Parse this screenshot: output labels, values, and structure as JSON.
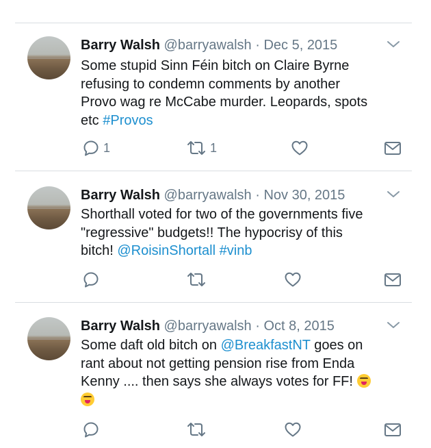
{
  "tweets": [
    {
      "author_name": "Barry Walsh",
      "handle": "@barryawalsh",
      "separator": "·",
      "date": "Dec 5, 2015",
      "text_lines": [
        [
          {
            "t": "Some stupid Sinn Féin bitch on Claire Byrne"
          }
        ],
        [
          {
            "t": "refusing to condemn comments by another"
          }
        ],
        [
          {
            "t": "Provo wag re McCabe murder. Leopards, spots"
          }
        ],
        [
          {
            "t": "etc "
          },
          {
            "t": "#Provos",
            "link": true
          }
        ]
      ],
      "reply_count": "1",
      "retweet_count": "1"
    },
    {
      "author_name": "Barry Walsh",
      "handle": "@barryawalsh",
      "separator": "·",
      "date": "Nov 30, 2015",
      "text_lines": [
        [
          {
            "t": "Shorthall voted for two of the governments five"
          }
        ],
        [
          {
            "t": "\"regressive\" budgets!! The hypocrisy of this"
          }
        ],
        [
          {
            "t": "bitch! "
          },
          {
            "t": "@RoisinShortall",
            "link": true
          },
          {
            "t": " "
          },
          {
            "t": "#vinb",
            "link": true
          }
        ]
      ],
      "reply_count": "",
      "retweet_count": ""
    },
    {
      "author_name": "Barry Walsh",
      "handle": "@barryawalsh",
      "separator": "·",
      "date": "Oct 8, 2015",
      "text_lines": [
        [
          {
            "t": "Some daft old bitch on "
          },
          {
            "t": "@BreakfastNT",
            "link": true
          },
          {
            "t": " goes on"
          }
        ],
        [
          {
            "t": "rant about not getting pension rise from Enda"
          }
        ],
        [
          {
            "t": "Kenny .... then says she always votes for FF! "
          },
          {
            "emoji": "squinting-face-with-tongue"
          }
        ],
        [
          {
            "emoji": "squinting-face-with-tongue"
          }
        ]
      ],
      "reply_count": "",
      "retweet_count": ""
    }
  ],
  "icons": {
    "reply": "reply-icon",
    "retweet": "retweet-icon",
    "like": "heart-icon",
    "dm": "envelope-icon",
    "menu": "chevron-down-icon"
  },
  "colors": {
    "text": "#14171a",
    "muted": "#657786",
    "link": "#1d8fcf",
    "divider": "#d9dde1"
  }
}
